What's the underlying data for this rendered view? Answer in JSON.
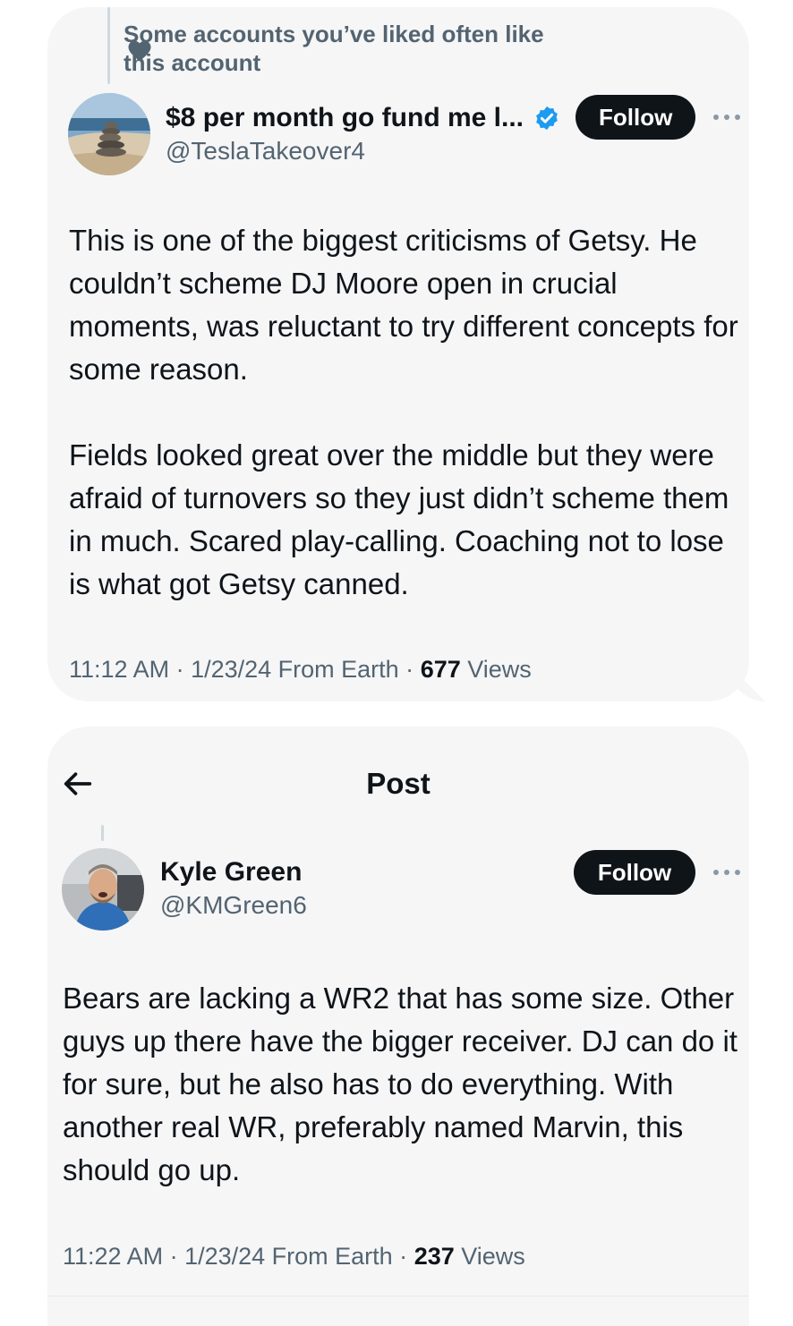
{
  "tweet1": {
    "social_context": "Some accounts you’ve liked often like this account",
    "display_name": "$8 per month go fund me l...",
    "handle": "@TeslaTakeover4",
    "follow_label": "Follow",
    "paragraphs": [
      "This is one of the biggest criticisms of Getsy. He couldn’t scheme DJ Moore open in crucial moments, was reluctant to try different concepts for some reason.",
      "Fields looked great over the middle but they were afraid of turnovers so they just didn’t scheme them in much. Scared play-calling. Coaching not to lose is what got Getsy canned."
    ],
    "meta_prefix": "11:12 AM · 1/23/24 From Earth · ",
    "views_count": "677",
    "views_label": " Views"
  },
  "tweet2": {
    "page_title": "Post",
    "display_name": "Kyle Green",
    "handle": "@KMGreen6",
    "follow_label": "Follow",
    "paragraphs": [
      "Bears are lacking a WR2 that has some size. Other guys up there have the bigger receiver. DJ can do it for sure, but he also has to do everything. With another real WR, preferably named Marvin, this should go up."
    ],
    "meta_prefix": "11:22 AM · 1/23/24 From Earth · ",
    "views_count": "237",
    "views_label": " Views"
  },
  "colors": {
    "card_bg": "#f6f6f7",
    "text_primary": "#0f1419",
    "text_secondary": "#536471",
    "verified_blue": "#1d9bf0",
    "button_bg": "#0f1419"
  },
  "icons": [
    "heart-icon",
    "verified-badge-icon",
    "more-icon",
    "back-arrow-icon"
  ]
}
